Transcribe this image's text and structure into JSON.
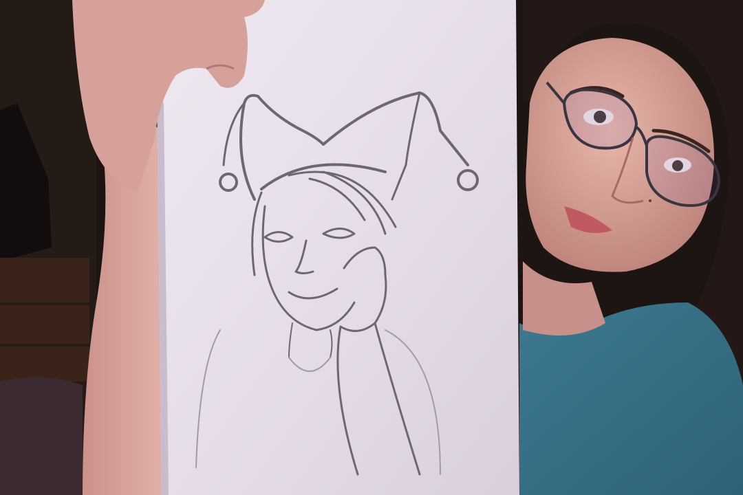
{
  "photo": {
    "subject": "webcam-photo",
    "colors": {
      "background_dark": "#1c1512",
      "wall": "#2a1f1a",
      "furniture": "#3a2318",
      "paper": "#e6dee9",
      "pencil": "#6e6672",
      "skin": "#d9a89e",
      "hair": "#231816",
      "shirt": "#3f7e95"
    }
  }
}
